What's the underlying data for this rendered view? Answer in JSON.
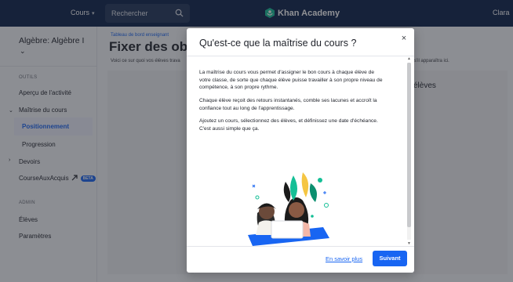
{
  "topbar": {
    "courses_label": "Cours",
    "search_placeholder": "Rechercher",
    "brand": "Khan Academy",
    "user_name": "Clara"
  },
  "sidebar": {
    "course_title": "Algèbre: Algèbre I",
    "tools_section": "OUTILS",
    "items": [
      {
        "label": "Aperçu de l'activité"
      },
      {
        "label": "Maîtrise du cours"
      },
      {
        "label": "Positionnement"
      },
      {
        "label": "Progression"
      },
      {
        "label": "Devoirs"
      },
      {
        "label": "CourseAuxAcquis",
        "badge": "BETA"
      }
    ],
    "admin_section": "ADMIN",
    "admin_items": [
      {
        "label": "Élèves"
      },
      {
        "label": "Paramètres"
      }
    ]
  },
  "main": {
    "breadcrumb": "Tableau de bord enseignant",
    "title": "Fixer des ob",
    "subtitle": "Voici ce sur quoi vos élèves trava",
    "subtitle_right": "s'il apparaîtra ici.",
    "right_card_label": "élèves"
  },
  "modal": {
    "title": "Qu'est-ce que la maîtrise du cours ?",
    "close_symbol": "×",
    "paragraphs": [
      "La maîtrise du cours vous permet d'assigner le bon cours à chaque élève de votre classe, de sorte que chaque élève puisse travailler à son propre niveau de compétence, à son propre rythme.",
      "Chaque élève reçoit des retours instantanés, comble ses lacunes et accroît la confiance tout au long de l'apprentissage.",
      "Ajoutez un cours, sélectionnez des élèves, et définissez une date d'échéance. C'est aussi simple que ça."
    ],
    "learn_more": "En savoir plus",
    "next_button": "Suivant"
  },
  "colors": {
    "topbar": "#0b2149",
    "accent": "#1865f2",
    "logo_green": "#14bf96"
  },
  "icons": [
    "search-icon",
    "khan-logo-icon",
    "chevron-down-icon",
    "external-link-icon",
    "close-icon",
    "caret-right-icon"
  ]
}
